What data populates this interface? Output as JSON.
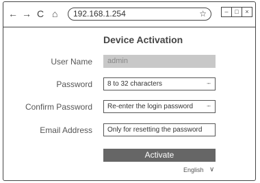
{
  "browser": {
    "back_icon": "←",
    "forward_icon": "→",
    "reload_icon": "C",
    "home_icon": "⌂",
    "url": "192.168.1.254",
    "bookmark_icon": "☆",
    "window_controls": {
      "minimize": "–",
      "maximize": "□",
      "close": "×"
    }
  },
  "page": {
    "title": "Device Activation",
    "form": {
      "username_label": "User Name",
      "username_value": "admin",
      "password_label": "Password",
      "password_placeholder": "8 to 32 characters",
      "confirm_label": "Confirm Password",
      "confirm_placeholder": "Re-enter the login password",
      "email_label": "Email Address",
      "email_placeholder": "Only for resetting the password",
      "eye_icon": "ᐧᐧᐧᐧ"
    },
    "activate_label": "Activate",
    "language": "English",
    "language_chevron": "∨"
  }
}
